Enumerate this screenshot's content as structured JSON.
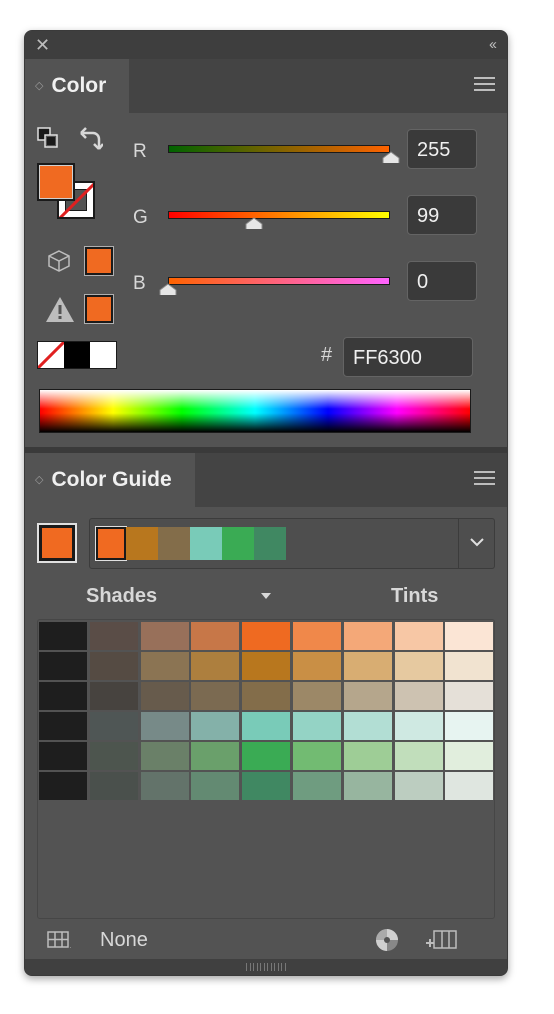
{
  "window": {
    "close_icon": "close-icon",
    "collapse_icon": "double-chevron-icon"
  },
  "color_panel": {
    "title": "Color",
    "fill_color": "#f06a21",
    "r": {
      "label": "R",
      "value": "255",
      "fraction": 1.0
    },
    "g": {
      "label": "G",
      "value": "99",
      "fraction": 0.388
    },
    "b": {
      "label": "B",
      "value": "0",
      "fraction": 0.0
    },
    "hex_prefix": "#",
    "hex_value": "FF6300"
  },
  "color_guide": {
    "title": "Color Guide",
    "base_color": "#f06a21",
    "harmony_colors": [
      "#f06a21",
      "#b8771e",
      "#836d4a",
      "#79cbb8",
      "#3aab54",
      "#408862"
    ],
    "shades_label": "Shades",
    "tints_label": "Tints",
    "grid": [
      [
        "#1e1e1e",
        "#5a4d47",
        "#98705a",
        "#c77748",
        "#ef6a21",
        "#f0884a",
        "#f4a878",
        "#f7c7a5",
        "#fbe5d5"
      ],
      [
        "#1e1e1e",
        "#554b43",
        "#8b7453",
        "#ad7f3e",
        "#b8771e",
        "#c98f45",
        "#d8ad72",
        "#e6c9a0",
        "#f1e3d0"
      ],
      [
        "#1e1e1e",
        "#47433f",
        "#675b4c",
        "#7b6a51",
        "#836d4a",
        "#9c8867",
        "#b5a68c",
        "#cdc2b1",
        "#e5e0d8"
      ],
      [
        "#1e1e1e",
        "#4f5655",
        "#778a88",
        "#84b1a9",
        "#79cbb8",
        "#94d3c5",
        "#b2ded4",
        "#cfe9e2",
        "#e7f4f1"
      ],
      [
        "#1e1e1e",
        "#4d554e",
        "#6a8068",
        "#6aa06b",
        "#3aab54",
        "#72bb72",
        "#9ecd96",
        "#c1debb",
        "#e1eedd"
      ],
      [
        "#1e1e1e",
        "#4a504c",
        "#63736a",
        "#638a72",
        "#408862",
        "#6f9c80",
        "#97b59f",
        "#bccdc0",
        "#dfe6e0"
      ]
    ],
    "library_label": "None"
  }
}
